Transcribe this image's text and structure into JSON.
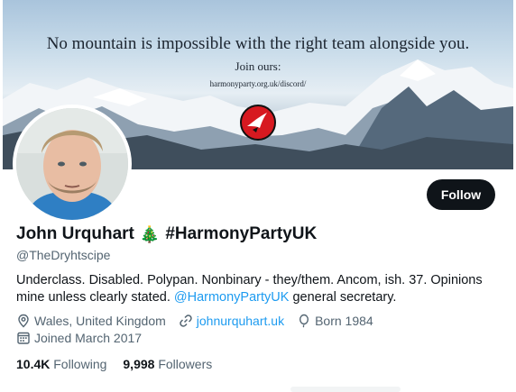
{
  "banner": {
    "headline": "No mountain is impossible with the right team alongside you.",
    "cta": "Join ours:",
    "url": "harmonyparty.org.uk/discord/",
    "logo_icon": "harmony-party-bird-logo"
  },
  "profile": {
    "display_name": "John Urquhart",
    "emoji": "🎄",
    "party_tag": "#HarmonyPartyUK",
    "handle": "@TheDryhtscipe",
    "bio_text": "Underclass. Disabled. Polypan. Nonbinary - they/them. Ancom, ish. 37. Opinions mine unless clearly stated.",
    "bio_mention": "@HarmonyPartyUK",
    "bio_suffix": "general secretary.",
    "location": "Wales, United Kingdom",
    "website": "johnurquhart.uk",
    "born": "Born 1984",
    "joined": "Joined March 2017"
  },
  "actions": {
    "follow_label": "Follow"
  },
  "stats": {
    "following_count": "10.4K",
    "following_label": "Following",
    "followers_count": "9,998",
    "followers_label": "Followers"
  },
  "colors": {
    "accent": "#1d9bf0",
    "button_bg": "#0f1419",
    "muted_text": "#536471"
  }
}
